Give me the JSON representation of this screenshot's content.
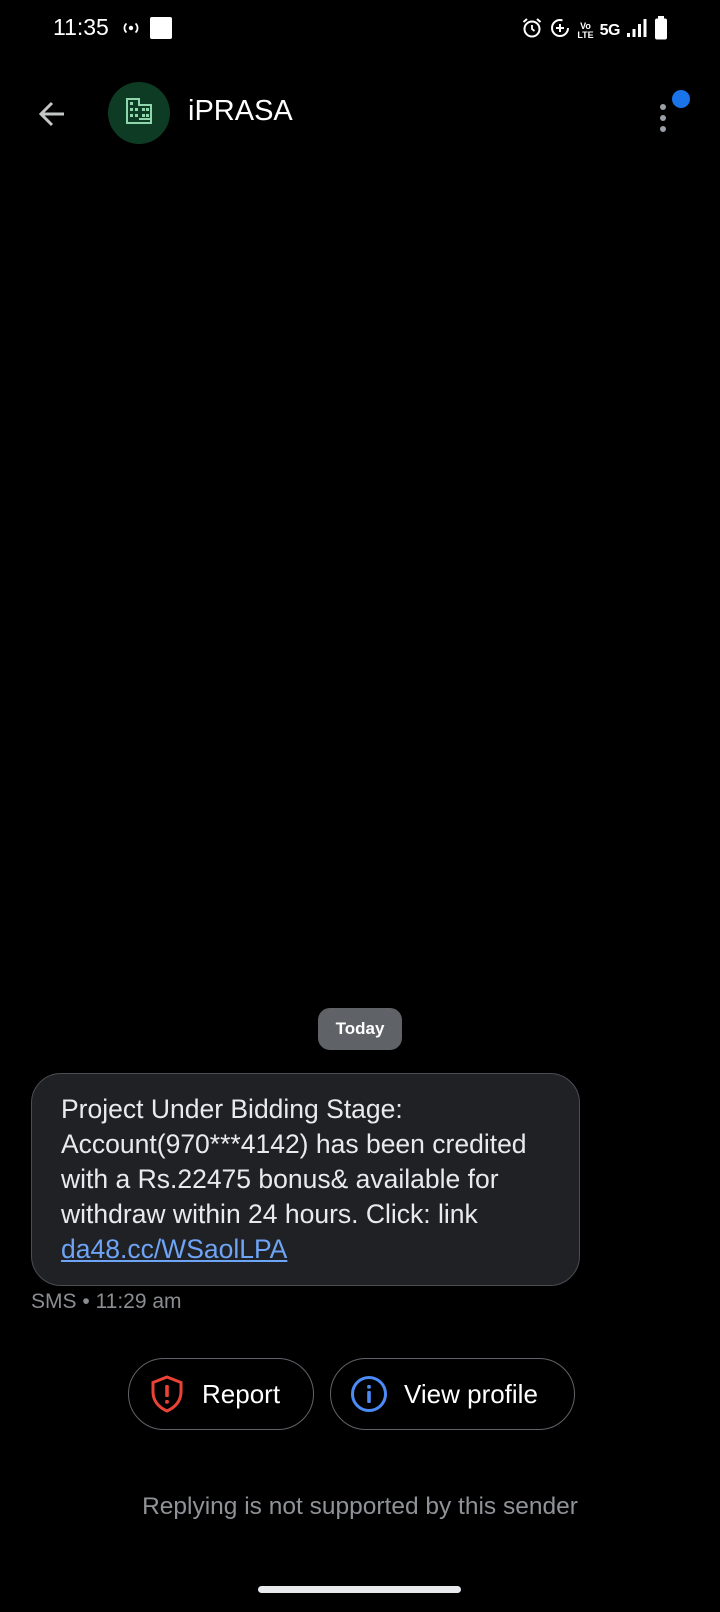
{
  "status_bar": {
    "time": "11:35",
    "network": "5G",
    "volte_top": "Vo",
    "volte_bottom": "LTE",
    "icons": [
      "hotspot-icon",
      "media-icon",
      "alarm-icon",
      "data-saver-icon",
      "volte-icon",
      "signal-icon",
      "battery-icon"
    ]
  },
  "header": {
    "contact_name": "iPRASA",
    "back_icon": "arrow-back-icon",
    "avatar_icon": "business-icon",
    "more_icon": "more-vert-icon",
    "notification_dot_color": "#1a73e8",
    "avatar_color": "#0e3b23"
  },
  "conversation": {
    "date_chip": "Today",
    "message": {
      "text": "Project Under Bidding Stage: Account(970***4142) has been credited with a Rs.22475 bonus& available for withdraw within 24 hours. Click: link ",
      "link": "da48.cc/WSaolLPA",
      "meta": "SMS • 11:29 am"
    }
  },
  "actions": {
    "report_label": "Report",
    "view_profile_label": "View profile",
    "report_icon": "shield-alert-icon",
    "view_profile_icon": "info-icon",
    "report_color": "#ea4335",
    "info_color": "#4c8bf5"
  },
  "footer": {
    "reply_note": "Replying is not supported by this sender"
  }
}
